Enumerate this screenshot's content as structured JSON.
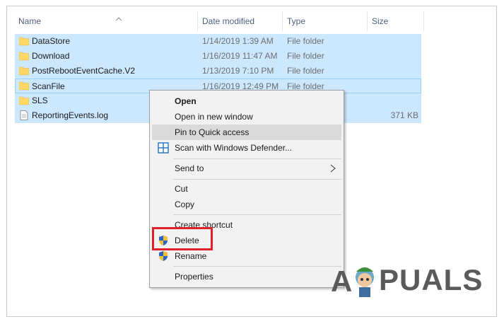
{
  "columns": {
    "name": "Name",
    "date": "Date modified",
    "type": "Type",
    "size": "Size"
  },
  "files": [
    {
      "name": "DataStore",
      "date": "1/14/2019 1:39 AM",
      "type": "File folder",
      "size": "",
      "icon": "folder-icon"
    },
    {
      "name": "Download",
      "date": "1/16/2019 11:47 AM",
      "type": "File folder",
      "size": "",
      "icon": "folder-icon"
    },
    {
      "name": "PostRebootEventCache.V2",
      "date": "1/13/2019 7:10 PM",
      "type": "File folder",
      "size": "",
      "icon": "folder-icon"
    },
    {
      "name": "ScanFile",
      "date": "1/16/2019 12:49 PM",
      "type": "File folder",
      "size": "",
      "icon": "folder-icon"
    },
    {
      "name": "SLS",
      "date": "",
      "type": "",
      "size": "",
      "icon": "folder-icon"
    },
    {
      "name": "ReportingEvents.log",
      "date": "",
      "type": "",
      "size": "371 KB",
      "icon": "text-file-icon"
    }
  ],
  "context_menu": {
    "open": "Open",
    "open_new_window": "Open in new window",
    "pin_quick_access": "Pin to Quick access",
    "scan_defender": "Scan with Windows Defender...",
    "send_to": "Send to",
    "cut": "Cut",
    "copy": "Copy",
    "create_shortcut": "Create shortcut",
    "delete": "Delete",
    "rename": "Rename",
    "properties": "Properties"
  },
  "watermark": "APPUALS",
  "colors": {
    "selection": "#cce8ff",
    "highlight_box": "#e0212b",
    "folder": "#ffd766"
  }
}
